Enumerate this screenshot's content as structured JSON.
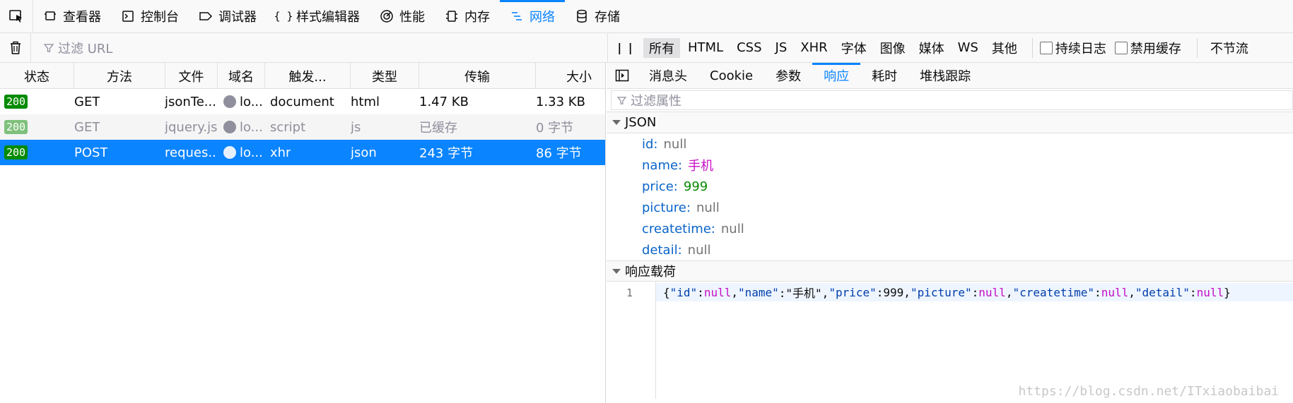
{
  "toolbar": {
    "tabs": [
      {
        "label": "查看器",
        "icon": "inspector-icon"
      },
      {
        "label": "控制台",
        "icon": "console-icon"
      },
      {
        "label": "调试器",
        "icon": "debugger-icon"
      },
      {
        "label": "样式编辑器",
        "icon": "style-editor-icon"
      },
      {
        "label": "性能",
        "icon": "performance-icon"
      },
      {
        "label": "内存",
        "icon": "memory-icon"
      },
      {
        "label": "网络",
        "icon": "network-icon",
        "active": true
      },
      {
        "label": "存储",
        "icon": "storage-icon"
      }
    ],
    "accent": "#0a84ff"
  },
  "filterbar": {
    "url_placeholder": "过滤 URL",
    "types": [
      "所有",
      "HTML",
      "CSS",
      "JS",
      "XHR",
      "字体",
      "图像",
      "媒体",
      "WS",
      "其他"
    ],
    "active_type": "所有",
    "persist_log": "持续日志",
    "disable_cache": "禁用缓存",
    "throttle": "不节流"
  },
  "table": {
    "headers": [
      "状态",
      "方法",
      "文件",
      "域名",
      "触发...",
      "类型",
      "传输",
      "大小"
    ],
    "rows": [
      {
        "status": "200",
        "method": "GET",
        "file": "jsonTe...",
        "domain": "lo...",
        "cause": "document",
        "type": "html",
        "transferred": "1.47 KB",
        "size": "1.33 KB"
      },
      {
        "status": "200",
        "method": "GET",
        "file": "jquery.js",
        "domain": "lo...",
        "cause": "script",
        "type": "js",
        "transferred": "已缓存",
        "size": "0 字节"
      },
      {
        "status": "200",
        "method": "POST",
        "file": "reques...",
        "domain": "lo...",
        "cause": "xhr",
        "type": "json",
        "transferred": "243 字节",
        "size": "86 字节"
      }
    ],
    "status_color": "#058b00"
  },
  "details": {
    "tabs": [
      "消息头",
      "Cookie",
      "参数",
      "响应",
      "耗时",
      "堆栈跟踪"
    ],
    "active_tab": "响应",
    "filter_placeholder": "过滤属性",
    "json_section": "JSON",
    "json_fields": [
      {
        "key": "id:",
        "value": "null",
        "kind": "null"
      },
      {
        "key": "name:",
        "value": "手机",
        "kind": "string"
      },
      {
        "key": "price:",
        "value": "999",
        "kind": "number"
      },
      {
        "key": "picture:",
        "value": "null",
        "kind": "null"
      },
      {
        "key": "createtime:",
        "value": "null",
        "kind": "null"
      },
      {
        "key": "detail:",
        "value": "null",
        "kind": "null"
      }
    ],
    "payload_section": "响应载荷",
    "line_number": "1",
    "payload_line": "{\"id\":null,\"name\":\"手机\",\"price\":999,\"picture\":null,\"createtime\":null,\"detail\":null}",
    "watermark": "https://blog.csdn.net/ITxiaobaibai"
  }
}
